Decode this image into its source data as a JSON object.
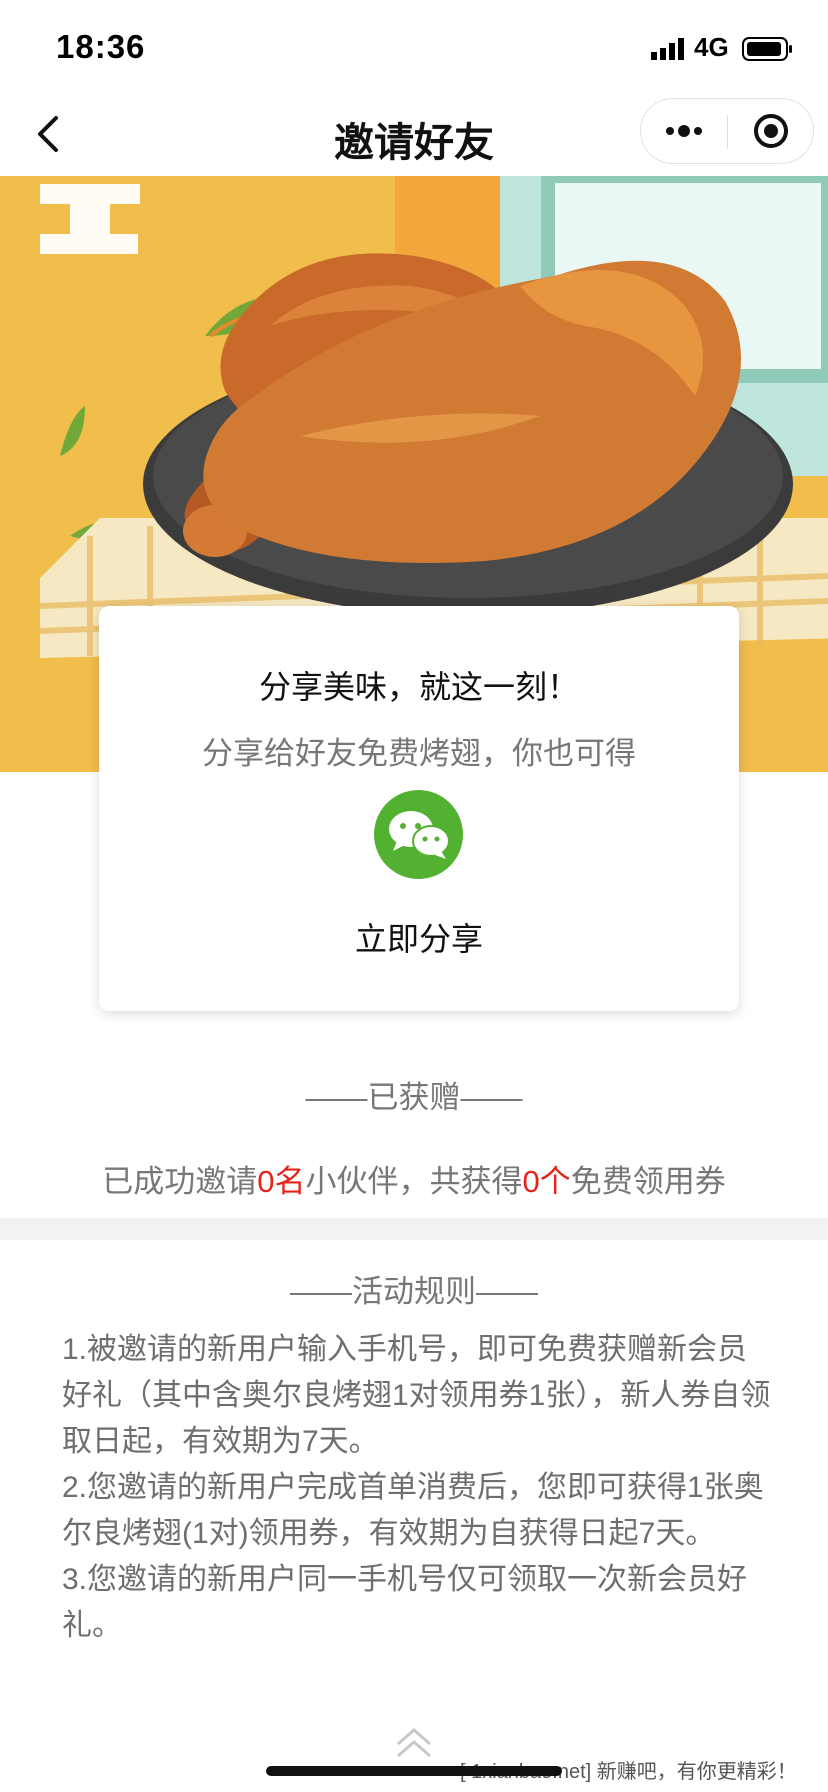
{
  "status_bar": {
    "time": "18:36",
    "network": "4G"
  },
  "nav": {
    "title": "邀请好友"
  },
  "card": {
    "title": "分享美味，就这一刻！",
    "subtitle": "分享给好友免费烤翅，你也可得",
    "share_label": "立即分享"
  },
  "received": {
    "heading": "——已获赠——",
    "prefix": "已成功邀请",
    "count_friends": "0名",
    "middle": "小伙伴，共获得",
    "count_coupons": "0个",
    "suffix": "免费领用券"
  },
  "rules": {
    "heading": "——活动规则——",
    "items": [
      "1.被邀请的新用户输入手机号，即可免费获赠新会员好礼（其中含奥尔良烤翅1对领用券1张），新人券自领取日起，有效期为7天。",
      "2.您邀请的新用户完成首单消费后，您即可获得1张奥尔良烤翅(1对)领用券，有效期为自获得日起7天。",
      "3.您邀请的新用户同一手机号仅可领取一次新会员好礼。"
    ]
  },
  "watermark": "[ 1xianbao.net] 新赚吧，有你更精彩！",
  "colors": {
    "accent_red": "#e8231c",
    "wechat_green": "#52b130",
    "hero_yellow": "#f1bd4b"
  }
}
